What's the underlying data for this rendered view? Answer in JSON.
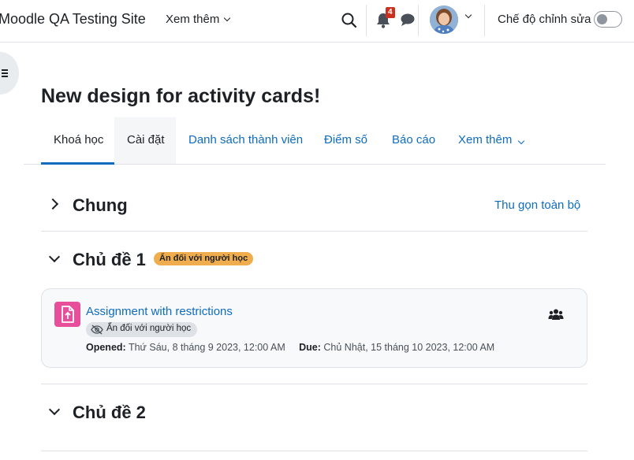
{
  "navbar": {
    "site_name": "Moodle QA Testing Site",
    "more_label": "Xem thêm",
    "notification_count": "4",
    "edit_mode_label": "Chế độ chỉnh sửa",
    "edit_mode_on": false
  },
  "page": {
    "title": "New design for activity cards!"
  },
  "tabs": [
    {
      "label": "Khoá học",
      "state": "active"
    },
    {
      "label": "Cài đặt",
      "state": "hover"
    },
    {
      "label": "Danh sách thành viên",
      "state": "normal"
    },
    {
      "label": "Điểm số",
      "state": "normal"
    },
    {
      "label": "Báo cáo",
      "state": "normal"
    },
    {
      "label": "Xem thêm",
      "state": "normal"
    }
  ],
  "sections": {
    "general": {
      "title": "Chung",
      "collapsed": true
    },
    "collapse_all_label": "Thu gọn toàn bộ",
    "topic1": {
      "title": "Chủ đề 1",
      "badge": "Ẩn đối với người học",
      "collapsed": false
    },
    "topic2": {
      "title": "Chủ đề 2",
      "collapsed": false
    }
  },
  "activity": {
    "name": "Assignment with restrictions",
    "hidden_label": "Ẩn đối với người học",
    "opened_label": "Opened:",
    "opened_value": "Thứ Sáu, 8 tháng 9 2023, 12:00 AM",
    "due_label": "Due:",
    "due_value": "Chủ Nhật, 15 tháng 10 2023, 12:00 AM",
    "icon": "assignment-icon"
  },
  "colors": {
    "link": "#0f6cbf",
    "badge_warning": "#f0ad4e",
    "notification_badge": "#ca3120",
    "assignment_icon_bg": "#e84f9a"
  }
}
